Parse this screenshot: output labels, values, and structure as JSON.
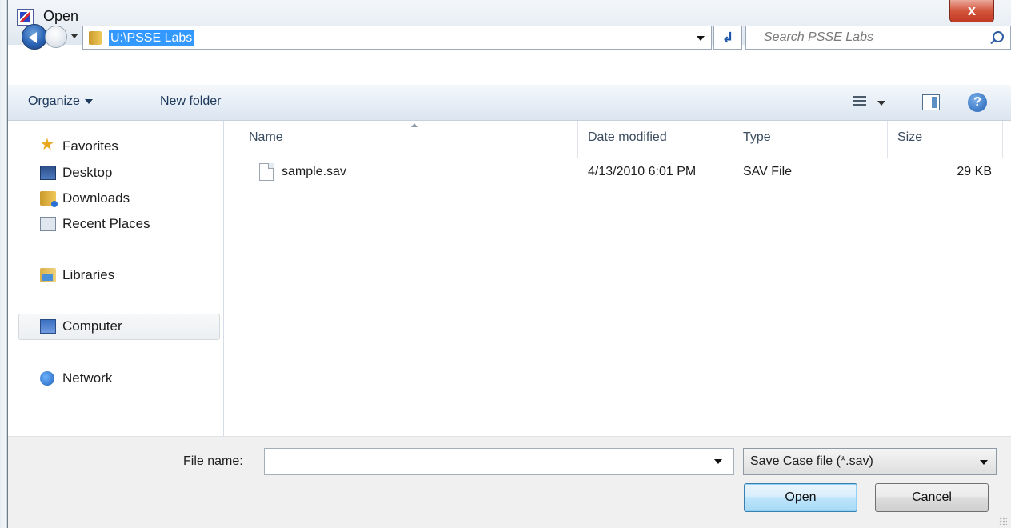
{
  "window": {
    "title": "Open",
    "close_label": "x"
  },
  "address": {
    "path": "U:\\PSSE Labs",
    "refresh_glyph": "↲",
    "search_placeholder": "Search PSSE Labs"
  },
  "toolbar": {
    "organize_label": "Organize",
    "new_folder_label": "New folder",
    "help_glyph": "?"
  },
  "nav": {
    "favorites": "Favorites",
    "desktop": "Desktop",
    "downloads": "Downloads",
    "recent_places": "Recent Places",
    "libraries": "Libraries",
    "computer": "Computer",
    "network": "Network"
  },
  "columns": {
    "name": "Name",
    "date_modified": "Date modified",
    "type": "Type",
    "size": "Size"
  },
  "files": [
    {
      "name": "sample.sav",
      "date_modified": "4/13/2010 6:01 PM",
      "type": "SAV File",
      "size": "29 KB"
    }
  ],
  "bottom": {
    "file_name_label": "File name:",
    "file_name_value": "",
    "filter_value": "Save Case file (*.sav)",
    "open_label": "Open",
    "cancel_label": "Cancel"
  },
  "icons": {
    "app": "psse-app-icon",
    "back": "back-arrow-icon",
    "forward": "forward-arrow-icon",
    "folder": "folder-icon",
    "search": "search-icon",
    "views": "views-icon",
    "preview": "preview-pane-icon",
    "help": "help-icon",
    "favorites": "star-icon",
    "desktop": "desktop-icon",
    "downloads": "downloads-folder-icon",
    "recent_places": "recent-places-icon",
    "libraries": "libraries-icon",
    "computer": "computer-icon",
    "network": "network-icon",
    "file": "file-icon"
  },
  "colors": {
    "selection": "#3399ff",
    "close_button": "#c23a22",
    "open_button_border": "#3c7fb1"
  }
}
